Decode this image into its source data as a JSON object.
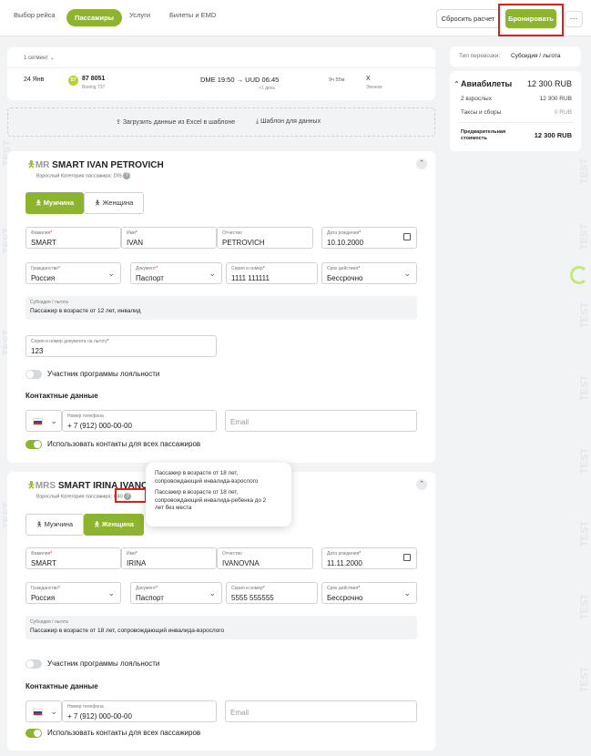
{
  "tabs": [
    "Выбор рейса",
    "Пассажиры",
    "Услуги",
    "Билеты и EMD"
  ],
  "actions": {
    "reset": "Сбросить расчет",
    "book": "Бронировать",
    "more": "⋯"
  },
  "segment": {
    "count_label": "1 сегмент",
    "date": "24 Янв",
    "airline_code": "S7",
    "flight": "87 8051",
    "aircraft": "Boeing 737",
    "route": "DME 19:50 → UUD 06:45",
    "next_day": "+1 день",
    "duration": "9ч 55м",
    "class_code": "X",
    "class_name": "Эконом"
  },
  "upload": {
    "excel": "Загрузить данные из Excel в шаблоне",
    "template": "Шаблон для данных"
  },
  "summary": {
    "type_label": "Тип перевозки:",
    "type_value": "Субсидия / льгота",
    "tickets_label": "Авиабилеты",
    "tickets_total": "12 300 RUB",
    "adults_label": "2 взрослых",
    "adults_value": "12 300 RUB",
    "taxes_label": "Таксы и сборы",
    "taxes_value": "0 RUB",
    "prelim_label": "Предварительная стоимость",
    "prelim_value": "12 300 RUB"
  },
  "passenger1": {
    "title_prefix": "MR",
    "title_name": "SMART IVAN PETROVICH",
    "category": "Взрослый  Категория пассажира: DIS",
    "gender_m": "Мужчина",
    "gender_f": "Женщина",
    "surname_label": "Фамилия",
    "surname": "SMART",
    "name_label": "Имя",
    "name": "IVAN",
    "patronymic_label": "Отчество",
    "patronymic": "PETROVICH",
    "dob_label": "Дата рождения",
    "dob": "10.10.2000",
    "citizenship_label": "Гражданство",
    "citizenship": "Россия",
    "doc_label": "Документ",
    "doc": "Паспорт",
    "series_label": "Серия и номер",
    "series": "1111 111111",
    "validity_label": "Срок действия",
    "validity": "Бессрочно",
    "subsidy_label": "Субсидия / льгота",
    "subsidy": "Пассажир в возрасте от 12 лет, инвалид",
    "benefit_doc_label": "Серия и номер документа на льготу",
    "benefit_doc": "123",
    "loyalty": "Участник программы лояльности",
    "contacts_title": "Контактные данные",
    "phone_label": "Номер телефона",
    "phone": "+ 7 (912) 000-00-00",
    "email_placeholder": "Email",
    "use_contacts": "Использовать контакты для всех пассажиров"
  },
  "passenger2": {
    "title_prefix": "MRS",
    "title_name": "SMART IRINA IVANO",
    "category_prefix": "Взрослый  Категория пассажира:",
    "category_code": "C40",
    "gender_m": "Мужчина",
    "gender_f": "Женщина",
    "surname_label": "Фамилия",
    "surname": "SMART",
    "name_label": "Имя",
    "name": "IRINA",
    "patronymic_label": "Отчество",
    "patronymic": "IVANOVNA",
    "dob_label": "Дата рождения",
    "dob": "11.11.2000",
    "citizenship_label": "Гражданство",
    "citizenship": "Россия",
    "doc_label": "Документ",
    "doc": "Паспорт",
    "series_label": "Серия и номер",
    "series": "5555 555555",
    "validity_label": "Срок действия",
    "validity": "Бессрочно",
    "subsidy_label": "Субсидия / льгота",
    "subsidy": "Пассажир в возрасте от 18 лет, сопровождающий инвалида-взрослого",
    "loyalty": "Участник программы лояльности",
    "contacts_title": "Контактные данные",
    "phone_label": "Номер телефона",
    "phone": "+ 7 (912) 000-00-00",
    "email_placeholder": "Email",
    "use_contacts": "Использовать контакты для всех пассажиров"
  },
  "tooltip": {
    "line1": "Пассажир в возрасте от 18 лет,",
    "line2": "сопровождающий инвалида-взрослого",
    "line3": "Пассажир в возрасте от 18 лет,",
    "line4": "сопровождающий инвалида-ребенка до 2",
    "line5": "лет без места"
  },
  "watermark": "TEST",
  "colors": {
    "accent": "#8cb42e",
    "highlight": "#e21b1b"
  }
}
